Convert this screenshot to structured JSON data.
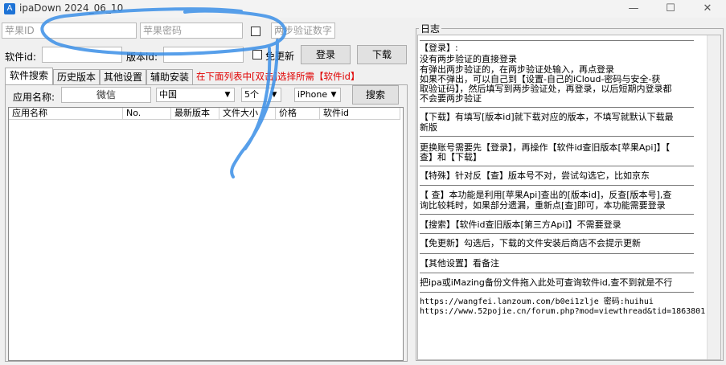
{
  "window": {
    "title": "ipaDown 2024_06_10",
    "icon": "app-store-icon",
    "controls": [
      "minimize-icon",
      "maximize-icon",
      "close-icon"
    ]
  },
  "login": {
    "apple_id_placeholder": "苹果ID",
    "password_placeholder": "苹果密码",
    "two_step_placeholder": "两步验证数字"
  },
  "row2": {
    "software_id_label": "软件id:",
    "version_id_label": "版本id:",
    "no_update_label": "免更新",
    "login_button": "登录",
    "download_button": "下载"
  },
  "tabs": [
    {
      "label": "软件搜索",
      "active": true
    },
    {
      "label": "历史版本",
      "active": false
    },
    {
      "label": "其他设置",
      "active": false
    },
    {
      "label": "辅助安装",
      "active": false
    }
  ],
  "hint": "在下面列表中[双击]选择所需【软件id】",
  "search": {
    "app_name_label": "应用名称:",
    "app_name_value": "微信",
    "region": "中国",
    "count": "5个",
    "device": "iPhone",
    "search_button": "搜索"
  },
  "table": {
    "columns": [
      "应用名称",
      "No.",
      "最新版本",
      "文件大小",
      "价格",
      "软件id"
    ],
    "rows": []
  },
  "log": {
    "title": "日志",
    "lines": [
      "【登录】:",
      "    没有两步验证的直接登录",
      "    有弹出两步验证的，在两步验证处输入，再点登录",
      "    如果不弹出，可以自己到【设置-自己的iCloud-密码与安全-获",
      "取验证码】，然后填写到两步验证处，再登录，以后短期内登录都",
      "不会要两步验证",
      "【下载】有填写[版本id]就下载对应的版本，不填写就默认下载最",
      "新版",
      "更换账号需要先【登录】，再操作【软件id查旧版本[苹果Api]】【",
      "查】和【下载】",
      "【特殊】针对反【查】版本号不对，尝试勾选它，比如京东",
      "【 查】本功能是利用[苹果Api]查出的[版本id]，反查[版本号],查",
      "询比较耗时，如果部分遗漏，重新点[查]即可，本功能需要登录",
      "【搜索】【软件id查旧版本[第三方Api]】不需要登录",
      "【免更新】勾选后，下载的文件安装后商店不会提示更新",
      "【其他设置】看备注",
      "把ipa或iMazing备份文件拖入此处可查询软件id,查不到就是不行",
      "https://wangfei.lanzoum.com/b0ei1zlje 密码:huihui",
      "https://www.52pojie.cn/forum.php?mod=viewthread&tid=1863801"
    ]
  },
  "colors": {
    "hint_red": "#e00000",
    "annotation_blue": "#3a8ee6"
  }
}
